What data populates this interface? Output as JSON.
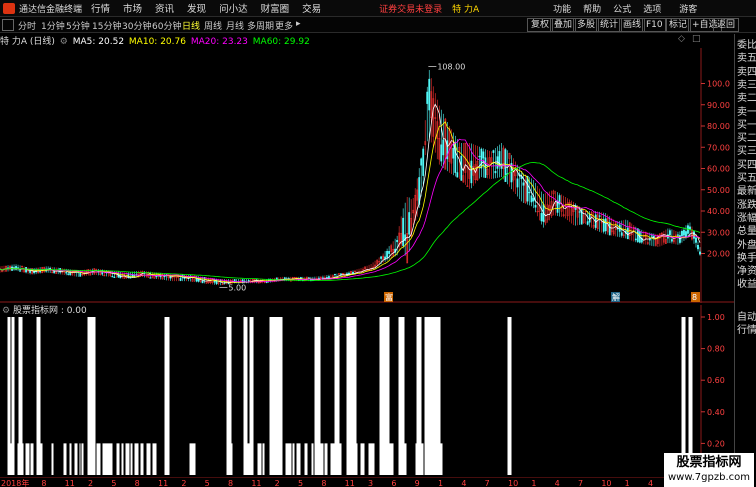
{
  "app": {
    "title": "通达信金融终端",
    "warning": "证券交易未登录",
    "stock_name": "特 力A"
  },
  "menu": [
    "行情",
    "市场",
    "资讯",
    "发现",
    "问小达",
    "财富圈",
    "交易"
  ],
  "right_menu": [
    "功能",
    "帮助",
    "公式",
    "选项",
    "游客"
  ],
  "toolbar": {
    "periods": [
      "分时",
      "1分钟",
      "5分钟",
      "15分钟",
      "30分钟",
      "60分钟",
      "日线",
      "周线",
      "月线",
      "多周期",
      "更多"
    ],
    "active_period": "日线",
    "buttons": [
      "复权",
      "叠加",
      "多股",
      "统计",
      "画线",
      "F10",
      "标记",
      "+自选",
      "返回"
    ]
  },
  "info": {
    "name_period": "特 力A (日线)",
    "ma5": "MA5: 20.52",
    "ma10": "MA10: 20.76",
    "ma20": "MA20: 23.23",
    "ma60": "MA60: 29.92"
  },
  "colors": {
    "ma5": "#ffffff",
    "ma10": "#ffff00",
    "ma20": "#ff00ff",
    "ma60": "#00ff00",
    "up": "#ff3232",
    "down": "#54ffff",
    "axis": "#ff3232"
  },
  "quote_panel": [
    "委比",
    "卖五",
    "卖四",
    "卖三",
    "卖二",
    "卖一",
    "买一",
    "买二",
    "买三",
    "买四",
    "买五",
    "最新",
    "涨跌",
    "涨幅",
    "总量",
    "外盘",
    "换手",
    "净资",
    "收益"
  ],
  "quote_panel_lower": [
    "自动",
    "行情"
  ],
  "chart_data": {
    "type": "candlestick",
    "title": "",
    "price_axis_ticks": [
      "100.0",
      "90.00",
      "80.00",
      "70.00",
      "60.00",
      "50.00",
      "40.00",
      "30.00",
      "20.00"
    ],
    "ylim": [
      0,
      112
    ],
    "high_label": "108.00",
    "low_label": "5.00",
    "event_markers": [
      "富",
      "解",
      "8"
    ],
    "profile_top": [
      [
        0,
        14
      ],
      [
        3,
        15
      ],
      [
        6,
        13
      ],
      [
        9,
        14
      ],
      [
        12,
        13
      ],
      [
        15,
        12
      ],
      [
        18,
        13
      ],
      [
        21,
        12
      ],
      [
        24,
        11
      ],
      [
        27,
        12
      ],
      [
        30,
        11
      ],
      [
        33,
        10
      ],
      [
        36,
        10
      ],
      [
        39,
        9
      ],
      [
        42,
        8
      ],
      [
        45,
        8
      ],
      [
        48,
        8
      ],
      [
        51,
        8
      ],
      [
        54,
        9
      ],
      [
        57,
        9
      ],
      [
        60,
        9
      ],
      [
        63,
        10
      ],
      [
        66,
        11
      ],
      [
        69,
        13
      ],
      [
        71,
        15
      ],
      [
        73,
        19
      ],
      [
        75,
        25
      ],
      [
        76,
        28
      ],
      [
        77,
        40
      ],
      [
        78,
        47
      ],
      [
        79,
        45
      ],
      [
        80,
        57
      ],
      [
        81,
        70
      ],
      [
        81.5,
        86
      ],
      [
        82,
        108
      ],
      [
        83,
        98
      ],
      [
        84,
        90
      ],
      [
        86,
        80
      ],
      [
        88,
        72
      ],
      [
        90,
        72
      ],
      [
        92,
        70
      ],
      [
        94,
        68
      ],
      [
        96,
        72
      ],
      [
        98,
        66
      ],
      [
        100,
        58
      ],
      [
        102,
        55
      ],
      [
        104,
        48
      ],
      [
        106,
        50
      ],
      [
        108,
        47
      ],
      [
        110,
        44
      ],
      [
        112,
        40
      ],
      [
        114,
        40
      ],
      [
        116,
        39
      ],
      [
        118,
        35
      ],
      [
        120,
        36
      ],
      [
        122,
        32
      ],
      [
        124,
        30
      ],
      [
        126,
        29
      ],
      [
        128,
        32
      ],
      [
        130,
        30
      ],
      [
        132,
        35
      ],
      [
        133,
        30
      ],
      [
        134,
        23
      ]
    ],
    "profile_low": [
      [
        0,
        11
      ],
      [
        3,
        12
      ],
      [
        6,
        10
      ],
      [
        9,
        11
      ],
      [
        12,
        10
      ],
      [
        15,
        9
      ],
      [
        18,
        10
      ],
      [
        21,
        9
      ],
      [
        24,
        8
      ],
      [
        27,
        9
      ],
      [
        30,
        8
      ],
      [
        33,
        7
      ],
      [
        36,
        7
      ],
      [
        39,
        6
      ],
      [
        42,
        5
      ],
      [
        45,
        6
      ],
      [
        48,
        6
      ],
      [
        51,
        6
      ],
      [
        54,
        7
      ],
      [
        57,
        7
      ],
      [
        60,
        7
      ],
      [
        63,
        8
      ],
      [
        66,
        9
      ],
      [
        69,
        11
      ],
      [
        71,
        12
      ],
      [
        73,
        15
      ],
      [
        75,
        18
      ],
      [
        76,
        19
      ],
      [
        77,
        24
      ],
      [
        78,
        15
      ],
      [
        79,
        33
      ],
      [
        80,
        38
      ],
      [
        81,
        52
      ],
      [
        81.5,
        70
      ],
      [
        82,
        75
      ],
      [
        83,
        70
      ],
      [
        84,
        62
      ],
      [
        86,
        58
      ],
      [
        88,
        55
      ],
      [
        90,
        50
      ],
      [
        92,
        56
      ],
      [
        94,
        55
      ],
      [
        96,
        56
      ],
      [
        98,
        50
      ],
      [
        100,
        44
      ],
      [
        102,
        42
      ],
      [
        104,
        32
      ],
      [
        106,
        38
      ],
      [
        108,
        37
      ],
      [
        110,
        33
      ],
      [
        112,
        34
      ],
      [
        114,
        31
      ],
      [
        116,
        29
      ],
      [
        118,
        28
      ],
      [
        120,
        27
      ],
      [
        122,
        25
      ],
      [
        124,
        24
      ],
      [
        126,
        23
      ],
      [
        128,
        25
      ],
      [
        130,
        24
      ],
      [
        132,
        28
      ],
      [
        133,
        24
      ],
      [
        134,
        19
      ]
    ],
    "x_labels": [
      "2018年",
      "8",
      "11",
      "2",
      "5",
      "8",
      "11",
      "2",
      "5",
      "8",
      "11",
      "2",
      "5",
      "8",
      "11",
      "3",
      "6",
      "9",
      "1",
      "4",
      "7",
      "10",
      "1",
      "4",
      "7",
      "10",
      "1",
      "4",
      "7",
      "10"
    ]
  },
  "indicator": {
    "title": "股票指标网 : 0.00",
    "axis_ticks": [
      "1.00",
      "0.80",
      "0.60",
      "0.40",
      "0.20"
    ],
    "ylim": [
      0,
      1
    ],
    "signal_x": [
      8,
      9,
      10,
      11,
      12,
      13,
      14,
      18,
      19,
      20,
      21,
      22,
      23,
      26,
      27,
      28,
      29,
      31,
      32,
      33,
      37,
      38,
      39,
      40,
      41,
      42,
      52,
      53,
      64,
      65,
      66,
      70,
      71,
      75,
      76,
      77,
      80,
      82,
      83,
      88,
      89,
      90,
      91,
      92,
      93,
      94,
      95,
      97,
      98,
      99,
      100,
      103,
      104,
      105,
      106,
      107,
      108,
      109,
      110,
      111,
      112,
      117,
      118,
      119,
      122,
      123,
      126,
      127,
      128,
      129,
      131,
      132,
      135,
      136,
      137,
      138,
      141,
      142,
      143,
      147,
      148,
      149,
      150,
      153,
      154,
      155,
      156,
      190,
      191,
      192,
      193,
      194,
      195,
      228,
      229,
      230,
      231,
      232,
      245,
      246,
      247,
      248,
      249,
      250,
      251,
      258,
      259,
      260,
      261,
      263,
      264,
      271,
      272,
      273,
      274,
      277,
      278,
      279,
      280,
      286,
      287,
      288,
      289,
      290,
      291,
      293,
      294,
      297,
      298,
      299,
      300,
      305,
      306,
      307,
      312,
      313,
      320,
      321,
      322,
      323,
      325,
      326,
      327,
      331,
      332,
      333,
      334,
      338,
      339,
      340,
      341,
      348,
      349,
      350,
      351,
      353,
      354,
      355,
      356,
      357,
      361,
      362,
      363,
      364,
      369,
      370,
      371,
      372,
      373,
      374,
      381,
      382,
      383,
      384,
      385,
      386,
      387,
      390,
      391,
      392,
      393,
      401,
      402,
      403,
      404,
      405,
      406,
      416,
      417,
      418,
      420,
      421,
      422,
      423,
      426,
      427,
      428,
      429,
      430,
      431,
      432,
      433,
      434,
      435,
      437,
      438,
      439,
      440,
      441,
      442,
      508,
      509,
      510,
      511,
      682,
      683,
      684,
      685,
      689,
      690,
      691,
      692
    ],
    "signal_full": [
      8,
      9,
      10,
      12,
      13,
      14,
      19,
      20,
      21,
      22,
      37,
      38,
      39,
      40,
      88,
      89,
      90,
      91,
      92,
      93,
      94,
      95,
      165,
      166,
      167,
      168,
      169,
      227,
      228,
      229,
      230,
      231,
      244,
      245,
      246,
      247,
      250,
      251,
      252,
      253,
      270,
      271,
      272,
      273,
      274,
      275,
      276,
      277,
      278,
      279,
      280,
      281,
      282,
      315,
      316,
      317,
      318,
      319,
      320,
      335,
      336,
      337,
      338,
      339,
      347,
      348,
      349,
      350,
      351,
      352,
      353,
      354,
      355,
      356,
      380,
      381,
      382,
      383,
      384,
      385,
      386,
      387,
      388,
      389,
      399,
      400,
      401,
      402,
      403,
      404,
      417,
      418,
      419,
      420,
      421,
      425,
      426,
      427,
      428,
      429,
      430,
      431,
      432,
      433,
      434,
      435,
      436,
      437,
      438,
      439,
      440,
      508,
      509,
      510,
      511,
      682,
      683,
      684,
      685,
      689,
      690,
      691,
      692
    ]
  },
  "watermark": {
    "main": "股票指标网",
    "url": "www.7gpzb.com"
  }
}
